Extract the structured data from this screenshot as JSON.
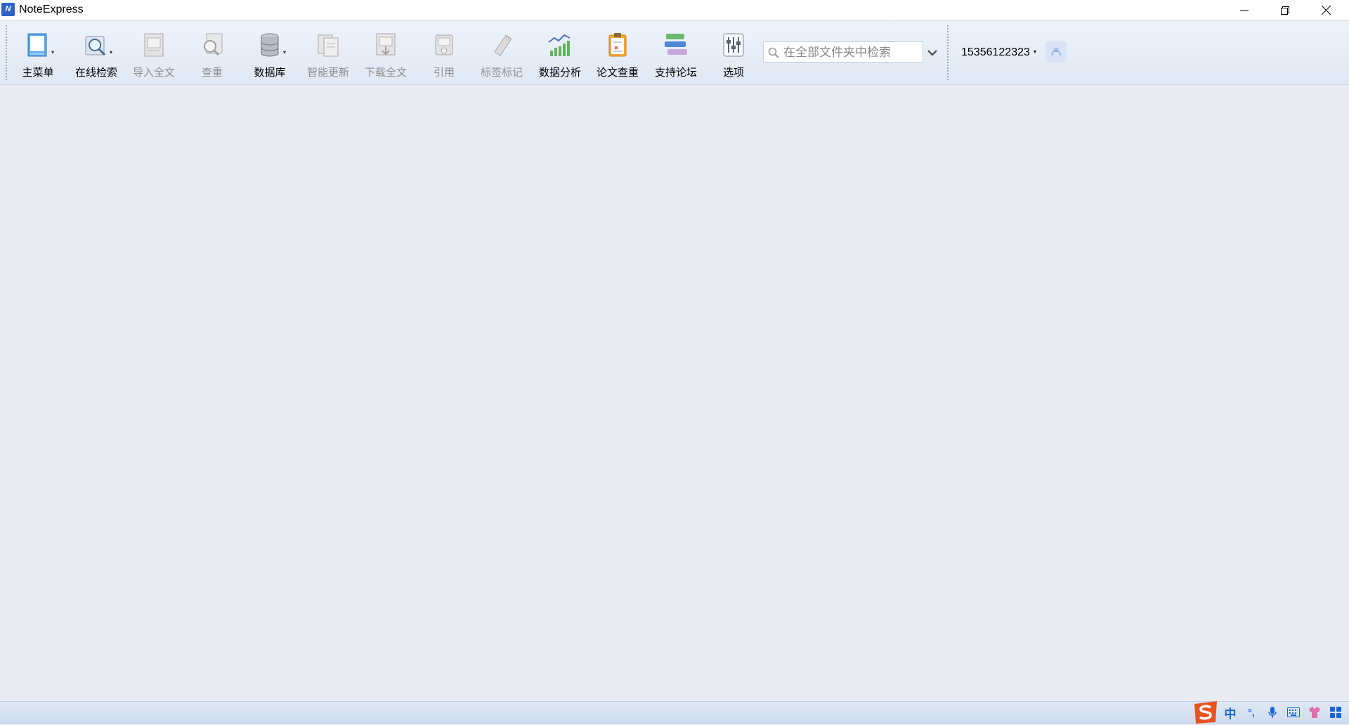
{
  "window": {
    "title": "NoteExpress",
    "app_icon_text": "N"
  },
  "toolbar": {
    "buttons": [
      {
        "label": "主菜单",
        "icon": "main-menu-icon",
        "enabled": true,
        "has_dropdown": true
      },
      {
        "label": "在线检索",
        "icon": "online-search-icon",
        "enabled": true,
        "has_dropdown": true
      },
      {
        "label": "导入全文",
        "icon": "import-fulltext-icon",
        "enabled": false,
        "has_dropdown": false
      },
      {
        "label": "查重",
        "icon": "duplicate-check-icon",
        "enabled": false,
        "has_dropdown": false
      },
      {
        "label": "数据库",
        "icon": "database-icon",
        "enabled": true,
        "has_dropdown": true
      },
      {
        "label": "智能更新",
        "icon": "smart-update-icon",
        "enabled": false,
        "has_dropdown": false
      },
      {
        "label": "下载全文",
        "icon": "download-fulltext-icon",
        "enabled": false,
        "has_dropdown": false
      },
      {
        "label": "引用",
        "icon": "cite-icon",
        "enabled": false,
        "has_dropdown": false
      },
      {
        "label": "标签标记",
        "icon": "tag-icon",
        "enabled": false,
        "has_dropdown": false
      },
      {
        "label": "数据分析",
        "icon": "data-analysis-icon",
        "enabled": true,
        "has_dropdown": false
      },
      {
        "label": "论文查重",
        "icon": "paper-check-icon",
        "enabled": true,
        "has_dropdown": false
      },
      {
        "label": "支持论坛",
        "icon": "forum-icon",
        "enabled": true,
        "has_dropdown": false
      },
      {
        "label": "选项",
        "icon": "options-icon",
        "enabled": true,
        "has_dropdown": false
      }
    ],
    "search": {
      "placeholder": "在全部文件夹中检索",
      "value": ""
    },
    "user": {
      "account": "15356122323"
    }
  },
  "dropdown_glyph": "▾",
  "ime_tray": {
    "items": [
      "中",
      "°,",
      "mic-icon",
      "keyboard-icon",
      "skin-icon",
      "grid-icon"
    ]
  },
  "colors": {
    "window_bg": "#e8ecf0",
    "toolbar_bg": "#e4ecf6",
    "accent": "#2f64c6",
    "disabled_text": "#8e8e8e"
  }
}
